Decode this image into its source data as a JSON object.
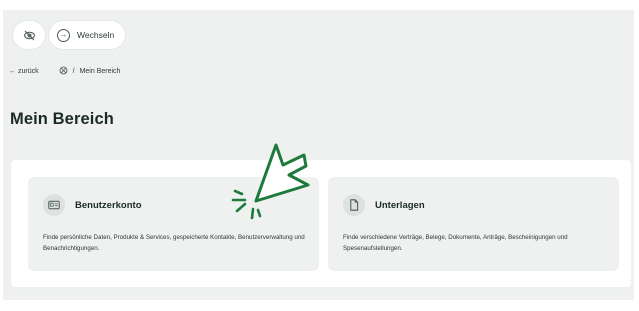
{
  "topbar": {
    "visibility_icon": "eye-off-icon",
    "switch_icon": "arrow-right-circle-icon",
    "switch_label": "Wechseln"
  },
  "breadcrumb": {
    "back_arrow": "←",
    "back_label": "zurück",
    "home_icon": "home-icon",
    "separator": "/",
    "current": "Mein Bereich"
  },
  "page": {
    "title": "Mein Bereich"
  },
  "cards": [
    {
      "icon": "id-card-icon",
      "title": "Benutzerkonto",
      "description": "Finde persönliche Daten, Produkte & Services, gespeicherte Kontakte, Benutzerverwaltung und Benachrichtigungen."
    },
    {
      "icon": "document-icon",
      "title": "Unterlagen",
      "description": "Finde verschiedene Verträge, Belege, Dokumente, Anträge, Bescheinigungen und Spesenaufstellungen."
    }
  ],
  "overlay": {
    "icon": "click-cursor-icon",
    "color": "#1e7a3c"
  }
}
